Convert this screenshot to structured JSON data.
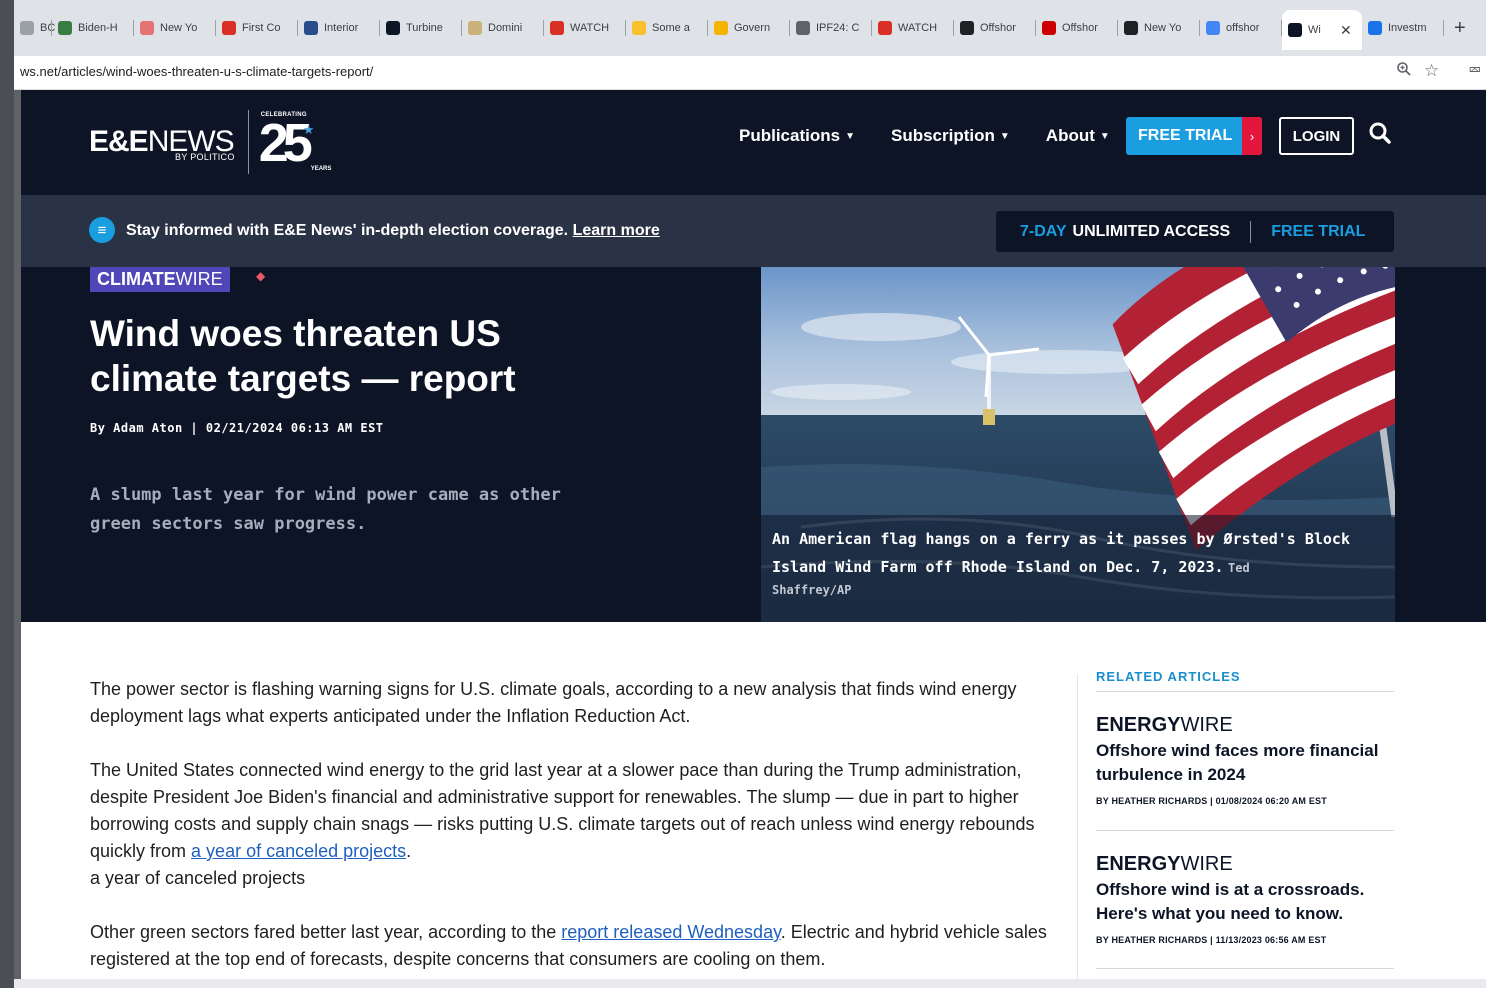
{
  "browser": {
    "tabs": [
      {
        "label": "BC",
        "icon": "partial-favicon",
        "color": "#9aa0a6"
      },
      {
        "label": "Biden-H",
        "icon": "green-seal-favicon",
        "color": "#3a7d44"
      },
      {
        "label": "New Yo",
        "icon": "red-circle-favicon",
        "color": "#e57373"
      },
      {
        "label": "First Co",
        "icon": "red-triangle-favicon",
        "color": "#d93025"
      },
      {
        "label": "Interior",
        "icon": "blue-seal-favicon",
        "color": "#2b4c8c"
      },
      {
        "label": "Turbine",
        "icon": "ee-favicon",
        "color": "#0c1426"
      },
      {
        "label": "Domini",
        "icon": "doc-favicon",
        "color": "#c9b37a"
      },
      {
        "label": "WATCH",
        "icon": "red-triangle-favicon",
        "color": "#d93025"
      },
      {
        "label": "Some a",
        "icon": "yellow-square-favicon",
        "color": "#fbc02d"
      },
      {
        "label": "Govern",
        "icon": "yellow-arrow-favicon",
        "color": "#f4b400"
      },
      {
        "label": "IPF24: C",
        "icon": "chart-favicon",
        "color": "#5f6368"
      },
      {
        "label": "WATCH",
        "icon": "red-triangle-favicon",
        "color": "#d93025"
      },
      {
        "label": "Offshor",
        "icon": "black-circle-favicon",
        "color": "#202124"
      },
      {
        "label": "Offshor",
        "icon": "cnn-favicon",
        "color": "#cc0000"
      },
      {
        "label": "New Yo",
        "icon": "black-circle-favicon",
        "color": "#202124"
      },
      {
        "label": "offshor",
        "icon": "google-favicon",
        "color": "#4285f4"
      },
      {
        "label": "Wi",
        "icon": "ee-favicon",
        "color": "#0c1426",
        "active": true
      },
      {
        "label": "Investm",
        "icon": "blue-square-favicon",
        "color": "#1a73e8"
      }
    ],
    "close_glyph": "✕",
    "new_tab_glyph": "+",
    "url": "ws.net/articles/wind-woes-threaten-u-s-climate-targets-report/"
  },
  "header": {
    "logo_ee": "E&E",
    "logo_news": "NEWS",
    "logo_by": "BY POLITICO",
    "logo_celebrating": "CELEBRATING",
    "logo_number": "25",
    "logo_years": "YEARS",
    "nav": [
      {
        "label": "Publications"
      },
      {
        "label": "Subscription"
      },
      {
        "label": "About"
      }
    ],
    "free_trial": "FREE TRIAL",
    "login": "LOGIN"
  },
  "promo": {
    "text": "Stay informed with E&E News' in-depth election coverage.",
    "link": "Learn more",
    "days": "7-DAY",
    "unlimited": "UNLIMITED ACCESS",
    "free_trial": "FREE TRIAL"
  },
  "article": {
    "section_bold": "CLIMATE",
    "section_light": "WIRE",
    "headline": "Wind woes threaten US climate targets — report",
    "byline": "By Adam Aton | 02/21/2024 06:13 AM EST",
    "dek": "A slump last year for wind power came as other green sectors saw progress.",
    "caption": "An American flag hangs on a ferry as it passes by Ørsted's Block Island Wind Farm off Rhode Island on Dec. 7, 2023.",
    "credit_a": "Ted",
    "credit_b": "Shaffrey/AP",
    "p1": "The power sector is flashing warning signs for U.S. climate goals, according to a new analysis that finds wind energy deployment lags what experts anticipated under the Inflation Reduction Act.",
    "p2_text": "The United States connected wind energy to the grid last year at a slower pace than during the Trump administration, despite President Joe Biden's financial and administrative support for renewables. The slump — due in part to higher borrowing costs and supply chain snags — risks putting U.S. climate targets out of reach unless wind energy rebounds quickly from",
    "p2_link": "a year of canceled projects",
    "p2_end": ".",
    "p2_extra": "a year of canceled projects",
    "p3_text": "Other green sectors fared better last year, according to the",
    "p3_link": "report released Wednesday",
    "p3_end": ". Electric and hybrid vehicle sales registered at the top end of forecasts, despite concerns that consumers are cooling on them."
  },
  "related": {
    "heading": "RELATED ARTICLES",
    "items": [
      {
        "pub_bold": "ENERGY",
        "pub_light": "WIRE",
        "title": "Offshore wind faces more financial turbulence in 2024",
        "meta": "BY HEATHER RICHARDS | 01/08/2024 06:20 AM EST"
      },
      {
        "pub_bold": "ENERGY",
        "pub_light": "WIRE",
        "title": "Offshore wind is at a crossroads. Here's what you need to know.",
        "meta": "BY HEATHER RICHARDS | 11/13/2023 06:56 AM EST"
      }
    ]
  },
  "colors": {
    "navy": "#0c1426",
    "accent_blue": "#1a9ee0",
    "accent_red": "#e3173e",
    "climatewire_purple": "#4f46b8"
  }
}
